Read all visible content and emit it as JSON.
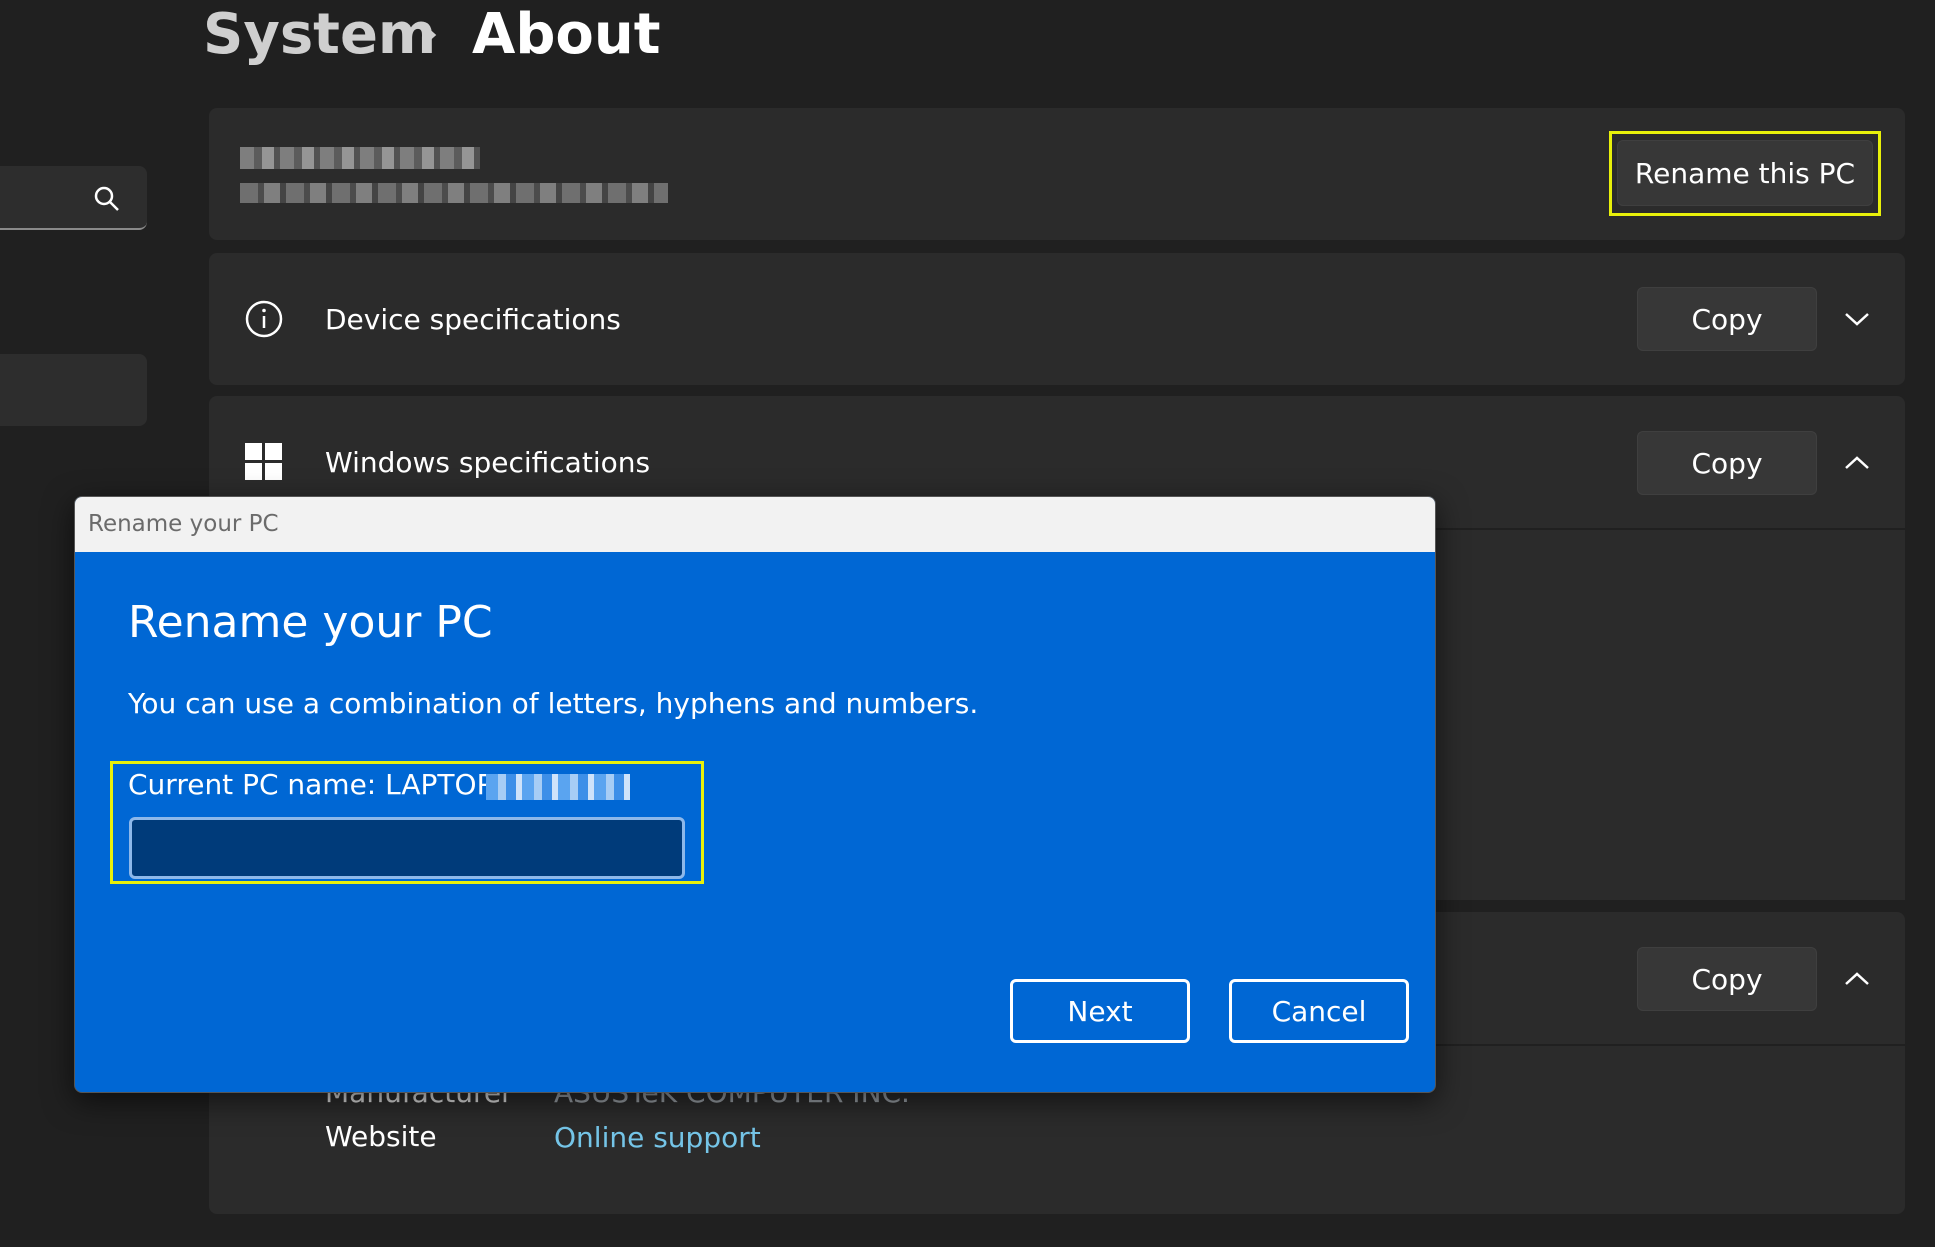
{
  "breadcrumb": {
    "parent": "System",
    "separator": "›",
    "current": "About"
  },
  "pc_card": {
    "rename_button": "Rename this PC"
  },
  "device_specs": {
    "title": "Device specifications",
    "copy_label": "Copy"
  },
  "windows_specs": {
    "title": "Windows specifications",
    "copy_label": "Copy"
  },
  "support": {
    "copy_label": "Copy",
    "manufacturer_label": "Manufacturer",
    "manufacturer_value": "ASUSTeK COMPUTER INC.",
    "website_label": "Website",
    "website_link": "Online support"
  },
  "dialog": {
    "window_title": "Rename your PC",
    "heading": "Rename your PC",
    "description": "You can use a combination of letters, hyphens and numbers.",
    "current_name_label": "Current PC name: LAPTOP-",
    "input_value": "",
    "next_label": "Next",
    "cancel_label": "Cancel"
  },
  "colors": {
    "background": "#202020",
    "card": "#2b2b2b",
    "dialog_blue": "#0067d4",
    "highlight": "#e8f00a",
    "link": "#75c5e8"
  }
}
